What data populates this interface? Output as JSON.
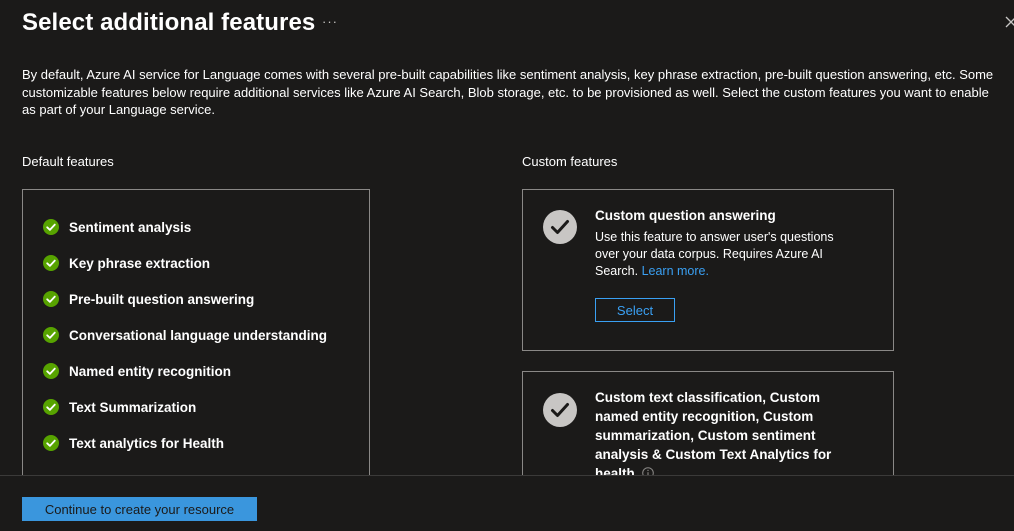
{
  "header": {
    "title": "Select additional features",
    "more_label": "···"
  },
  "intro_text": "By default, Azure AI service for Language comes with several pre-built capabilities like sentiment analysis, key phrase extraction, pre-built question answering, etc. Some customizable features below require additional services like Azure AI Search, Blob storage, etc. to be provisioned as well. Select the custom features you want to enable as part of your Language service.",
  "default_features": {
    "label": "Default features",
    "items": [
      "Sentiment analysis",
      "Key phrase extraction",
      "Pre-built question answering",
      "Conversational language understanding",
      "Named entity recognition",
      "Text Summarization",
      "Text analytics for Health"
    ]
  },
  "custom_features": {
    "label": "Custom features",
    "cards": [
      {
        "title": "Custom question answering",
        "description": "Use this feature to answer user's questions over your data corpus. Requires Azure AI Search.",
        "link_text": "Learn more.",
        "button_label": "Select"
      },
      {
        "title": "Custom text classification, Custom named entity recognition, Custom summarization, Custom sentiment analysis & Custom Text Analytics for health"
      }
    ]
  },
  "footer": {
    "primary_label": "Continue to create your resource"
  },
  "colors": {
    "background": "#1b1a19",
    "accent": "#3a96dd",
    "link": "#3aa0f3",
    "success": "#57a300",
    "check_gray": "#c8c6c4"
  },
  "icons": {
    "default_check": "check-circle-green-icon",
    "card_check": "check-circle-gray-icon",
    "close": "close-icon",
    "info": "info-icon"
  }
}
